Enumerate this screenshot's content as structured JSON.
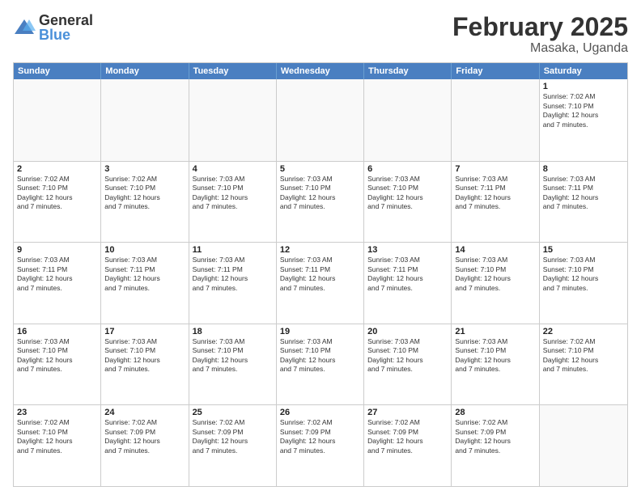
{
  "logo": {
    "general": "General",
    "blue": "Blue"
  },
  "title": "February 2025",
  "location": "Masaka, Uganda",
  "days_of_week": [
    "Sunday",
    "Monday",
    "Tuesday",
    "Wednesday",
    "Thursday",
    "Friday",
    "Saturday"
  ],
  "weeks": [
    [
      {
        "day": "",
        "info": ""
      },
      {
        "day": "",
        "info": ""
      },
      {
        "day": "",
        "info": ""
      },
      {
        "day": "",
        "info": ""
      },
      {
        "day": "",
        "info": ""
      },
      {
        "day": "",
        "info": ""
      },
      {
        "day": "1",
        "info": "Sunrise: 7:02 AM\nSunset: 7:10 PM\nDaylight: 12 hours\nand 7 minutes."
      }
    ],
    [
      {
        "day": "2",
        "info": "Sunrise: 7:02 AM\nSunset: 7:10 PM\nDaylight: 12 hours\nand 7 minutes."
      },
      {
        "day": "3",
        "info": "Sunrise: 7:02 AM\nSunset: 7:10 PM\nDaylight: 12 hours\nand 7 minutes."
      },
      {
        "day": "4",
        "info": "Sunrise: 7:03 AM\nSunset: 7:10 PM\nDaylight: 12 hours\nand 7 minutes."
      },
      {
        "day": "5",
        "info": "Sunrise: 7:03 AM\nSunset: 7:10 PM\nDaylight: 12 hours\nand 7 minutes."
      },
      {
        "day": "6",
        "info": "Sunrise: 7:03 AM\nSunset: 7:10 PM\nDaylight: 12 hours\nand 7 minutes."
      },
      {
        "day": "7",
        "info": "Sunrise: 7:03 AM\nSunset: 7:11 PM\nDaylight: 12 hours\nand 7 minutes."
      },
      {
        "day": "8",
        "info": "Sunrise: 7:03 AM\nSunset: 7:11 PM\nDaylight: 12 hours\nand 7 minutes."
      }
    ],
    [
      {
        "day": "9",
        "info": "Sunrise: 7:03 AM\nSunset: 7:11 PM\nDaylight: 12 hours\nand 7 minutes."
      },
      {
        "day": "10",
        "info": "Sunrise: 7:03 AM\nSunset: 7:11 PM\nDaylight: 12 hours\nand 7 minutes."
      },
      {
        "day": "11",
        "info": "Sunrise: 7:03 AM\nSunset: 7:11 PM\nDaylight: 12 hours\nand 7 minutes."
      },
      {
        "day": "12",
        "info": "Sunrise: 7:03 AM\nSunset: 7:11 PM\nDaylight: 12 hours\nand 7 minutes."
      },
      {
        "day": "13",
        "info": "Sunrise: 7:03 AM\nSunset: 7:11 PM\nDaylight: 12 hours\nand 7 minutes."
      },
      {
        "day": "14",
        "info": "Sunrise: 7:03 AM\nSunset: 7:10 PM\nDaylight: 12 hours\nand 7 minutes."
      },
      {
        "day": "15",
        "info": "Sunrise: 7:03 AM\nSunset: 7:10 PM\nDaylight: 12 hours\nand 7 minutes."
      }
    ],
    [
      {
        "day": "16",
        "info": "Sunrise: 7:03 AM\nSunset: 7:10 PM\nDaylight: 12 hours\nand 7 minutes."
      },
      {
        "day": "17",
        "info": "Sunrise: 7:03 AM\nSunset: 7:10 PM\nDaylight: 12 hours\nand 7 minutes."
      },
      {
        "day": "18",
        "info": "Sunrise: 7:03 AM\nSunset: 7:10 PM\nDaylight: 12 hours\nand 7 minutes."
      },
      {
        "day": "19",
        "info": "Sunrise: 7:03 AM\nSunset: 7:10 PM\nDaylight: 12 hours\nand 7 minutes."
      },
      {
        "day": "20",
        "info": "Sunrise: 7:03 AM\nSunset: 7:10 PM\nDaylight: 12 hours\nand 7 minutes."
      },
      {
        "day": "21",
        "info": "Sunrise: 7:03 AM\nSunset: 7:10 PM\nDaylight: 12 hours\nand 7 minutes."
      },
      {
        "day": "22",
        "info": "Sunrise: 7:02 AM\nSunset: 7:10 PM\nDaylight: 12 hours\nand 7 minutes."
      }
    ],
    [
      {
        "day": "23",
        "info": "Sunrise: 7:02 AM\nSunset: 7:10 PM\nDaylight: 12 hours\nand 7 minutes."
      },
      {
        "day": "24",
        "info": "Sunrise: 7:02 AM\nSunset: 7:09 PM\nDaylight: 12 hours\nand 7 minutes."
      },
      {
        "day": "25",
        "info": "Sunrise: 7:02 AM\nSunset: 7:09 PM\nDaylight: 12 hours\nand 7 minutes."
      },
      {
        "day": "26",
        "info": "Sunrise: 7:02 AM\nSunset: 7:09 PM\nDaylight: 12 hours\nand 7 minutes."
      },
      {
        "day": "27",
        "info": "Sunrise: 7:02 AM\nSunset: 7:09 PM\nDaylight: 12 hours\nand 7 minutes."
      },
      {
        "day": "28",
        "info": "Sunrise: 7:02 AM\nSunset: 7:09 PM\nDaylight: 12 hours\nand 7 minutes."
      },
      {
        "day": "",
        "info": ""
      }
    ]
  ]
}
